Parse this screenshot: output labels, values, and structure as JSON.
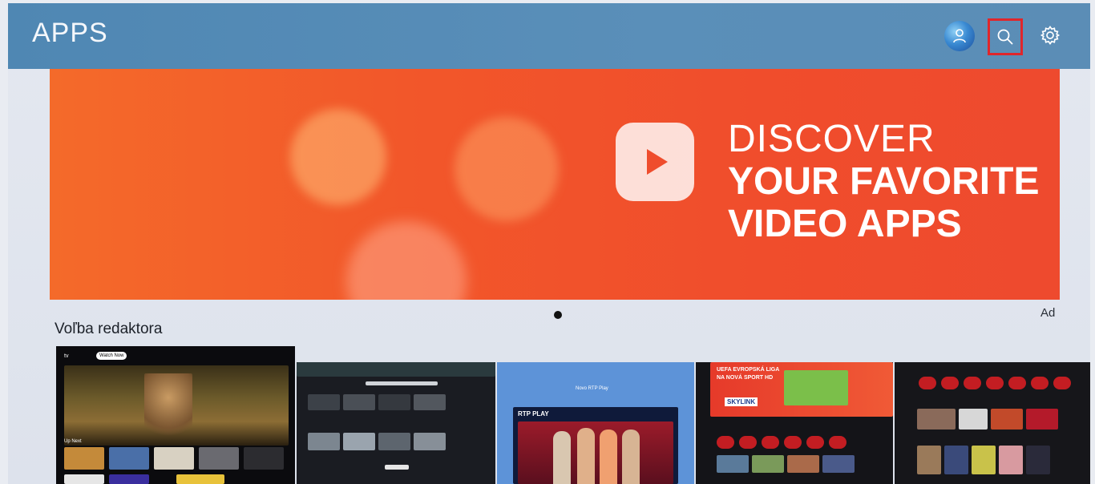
{
  "header": {
    "title": "APPS",
    "icons": [
      "profile-icon",
      "search-icon",
      "gear-icon"
    ],
    "accent": "#5a8fb9",
    "focus_color": "#e0262b"
  },
  "banner": {
    "line1": "DISCOVER",
    "line2": "YOUR FAVORITE",
    "line3": "VIDEO APPS",
    "icon": "play-icon",
    "bg_color": "#f2572a"
  },
  "carousel": {
    "ad_label": "Ad"
  },
  "editors_choice": {
    "title": "Voľba redaktora",
    "tiles": [
      {
        "name": "apple-tv",
        "labels": {
          "brand": "tv",
          "tab_active": "Watch Now",
          "up_next": "Up Next"
        }
      },
      {
        "name": "streaming-app"
      },
      {
        "name": "rtp-play",
        "labels": {
          "title": "Novo RTP Play",
          "brand": "RTP PLAY"
        }
      },
      {
        "name": "skylink",
        "labels": {
          "headline1": "UEFA EVROPSKÁ LIGA",
          "headline2": "NA NOVÁ SPORT HD",
          "brand": "SKYLINK"
        }
      },
      {
        "name": "tv-app"
      }
    ]
  }
}
